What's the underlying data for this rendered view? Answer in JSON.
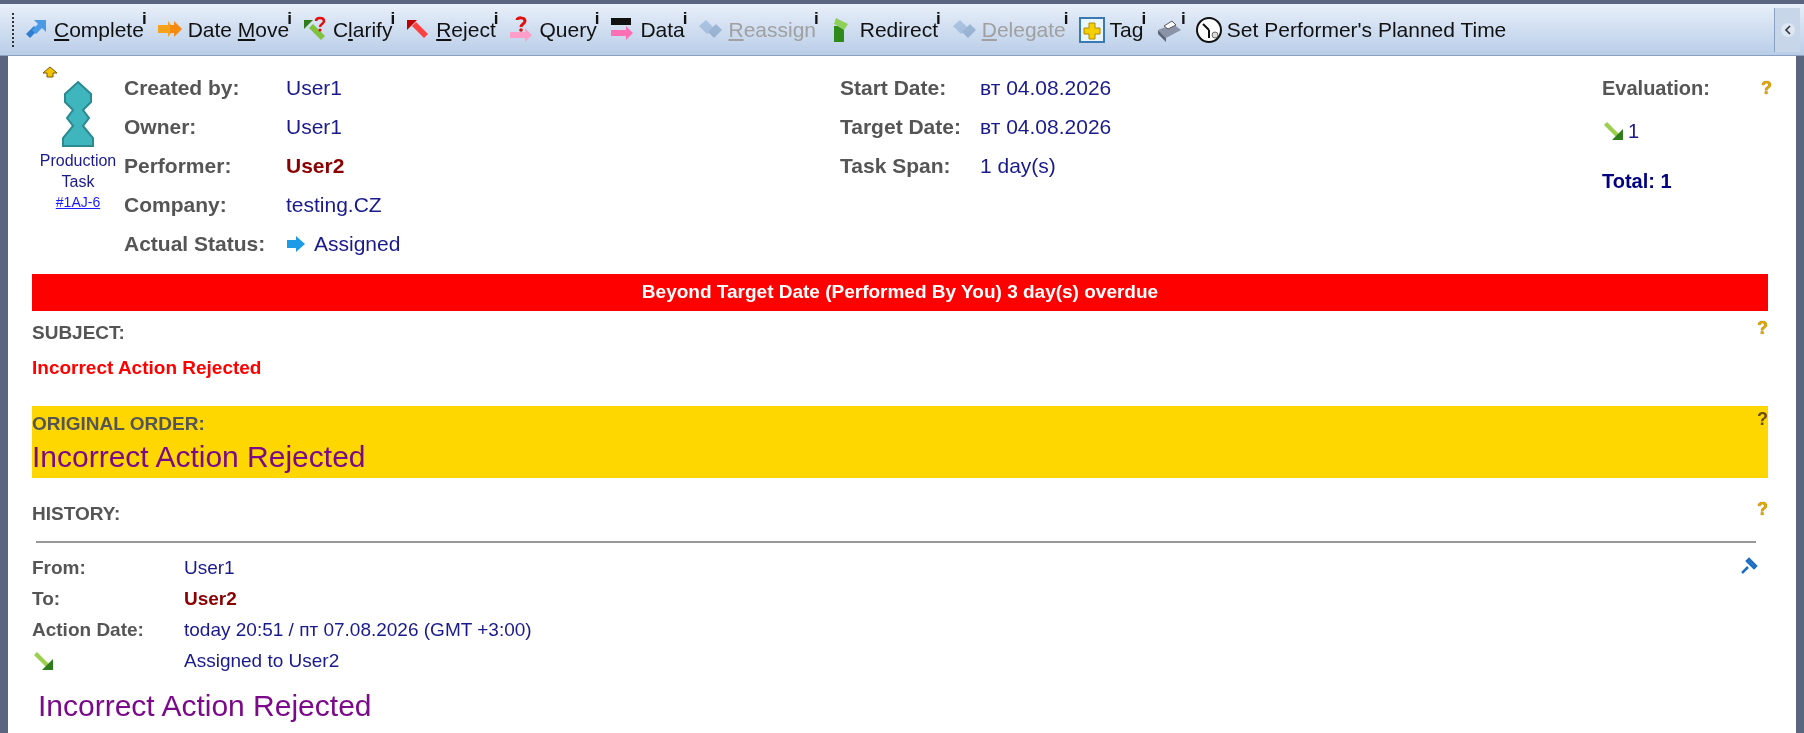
{
  "toolbar": {
    "items": [
      {
        "kind": "complete",
        "key": "C",
        "after": "omplete",
        "info": "i",
        "disabled": false
      },
      {
        "kind": "date_move",
        "before": "Date ",
        "key": "M",
        "after": "ove",
        "info": "i",
        "disabled": false
      },
      {
        "kind": "clarify",
        "before": "C",
        "key": "l",
        "after": "arify",
        "info": "i",
        "disabled": false
      },
      {
        "kind": "reject",
        "key": "R",
        "after": "eject",
        "info": "i",
        "disabled": false
      },
      {
        "kind": "query",
        "before": "Query",
        "info": "i",
        "disabled": false
      },
      {
        "kind": "data",
        "before": "Data",
        "info": "i",
        "disabled": false
      },
      {
        "kind": "reassign",
        "key": "R",
        "after": "eassign",
        "info": "i",
        "disabled": true
      },
      {
        "kind": "redirect",
        "before": "Redirect",
        "info": "i",
        "disabled": false
      },
      {
        "kind": "delegate",
        "key": "D",
        "after": "elegate",
        "info": "i",
        "disabled": true
      },
      {
        "kind": "tag",
        "before": "Tag",
        "info": "i",
        "disabled": false
      },
      {
        "kind": "print",
        "info": "i",
        "disabled": false
      },
      {
        "kind": "planned_time",
        "before": "Set Performer's Planned Time",
        "disabled": false
      }
    ]
  },
  "task": {
    "type": "Production Task",
    "id": "#1AJ-6"
  },
  "fields_left": [
    {
      "label": "Created by:",
      "value": "User1",
      "highlight": false
    },
    {
      "label": "Owner:",
      "value": "User1",
      "highlight": false
    },
    {
      "label": "Performer:",
      "value": "User2",
      "highlight": true
    },
    {
      "label": "Company:",
      "value": "testing.CZ",
      "highlight": false
    },
    {
      "label": "Actual Status:",
      "value": "Assigned",
      "highlight": false,
      "kind": "status"
    }
  ],
  "fields_middle": [
    {
      "label": "Start Date:",
      "value": "вт 04.08.2026",
      "highlight": false
    },
    {
      "label": "Target Date:",
      "value": "вт 04.08.2026",
      "highlight": false
    },
    {
      "label": "Task Span:",
      "value": "1 day(s)",
      "highlight": false
    }
  ],
  "evaluation": {
    "label": "Evaluation:",
    "help": "?",
    "score": "1",
    "total": "Total: 1"
  },
  "alert": "Beyond Target Date (Performed By You) 3 day(s) overdue",
  "subject": {
    "label": "SUBJECT:",
    "text": "Incorrect Action Rejected",
    "help": "?"
  },
  "original_order": {
    "label": "ORIGINAL ORDER:",
    "text": "Incorrect Action Rejected",
    "help": "?"
  },
  "history": {
    "label": "HISTORY:",
    "help": "?",
    "entries": [
      {
        "fields": [
          {
            "label": "From:",
            "value": "User1",
            "highlight": false
          },
          {
            "label": "To:",
            "value": "User2",
            "highlight": true
          },
          {
            "label": "Action Date:",
            "value": "today 20:51 / пт 07.08.2026 (GMT +3:00)",
            "highlight": false
          }
        ],
        "action": "Assigned to User2",
        "message": "Incorrect Action Rejected"
      }
    ]
  }
}
